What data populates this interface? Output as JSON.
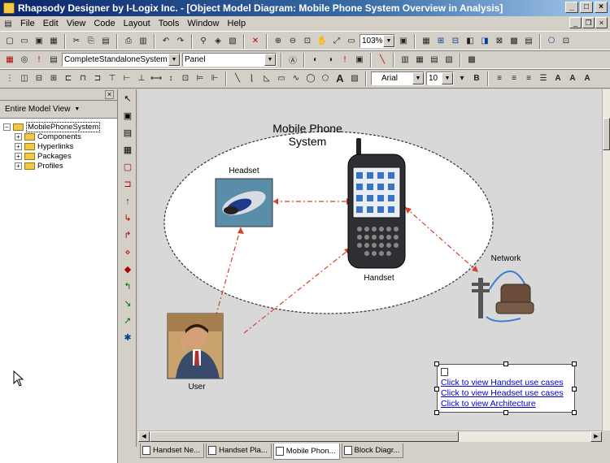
{
  "window": {
    "title": "Rhapsody Designer by I-Logix Inc. - [Object Model Diagram: Mobile Phone System Overview in Analysis]"
  },
  "menu": [
    "File",
    "Edit",
    "View",
    "Code",
    "Layout",
    "Tools",
    "Window",
    "Help"
  ],
  "toolbar": {
    "zoom": "103%",
    "config": "CompleteStandaloneSystem",
    "panel": "Panel",
    "font_name": "Arial",
    "font_size": "10"
  },
  "browser": {
    "view": "Entire Model View",
    "root": "MobilePhoneSystem",
    "items": [
      "Components",
      "Hyperlinks",
      "Packages",
      "Profiles"
    ]
  },
  "diagram": {
    "system_title": "Mobile Phone System",
    "headset_label": "Headset",
    "handset_label": "Handset",
    "network_label": "Network",
    "user_label": "User",
    "links": [
      "Click to view Handset use cases",
      "Click to view Headset use cases",
      "Click to view Architecture"
    ]
  },
  "tabs": [
    "Handset Ne...",
    "Handset Pla...",
    "Mobile Phon...",
    "Block Diagr..."
  ]
}
